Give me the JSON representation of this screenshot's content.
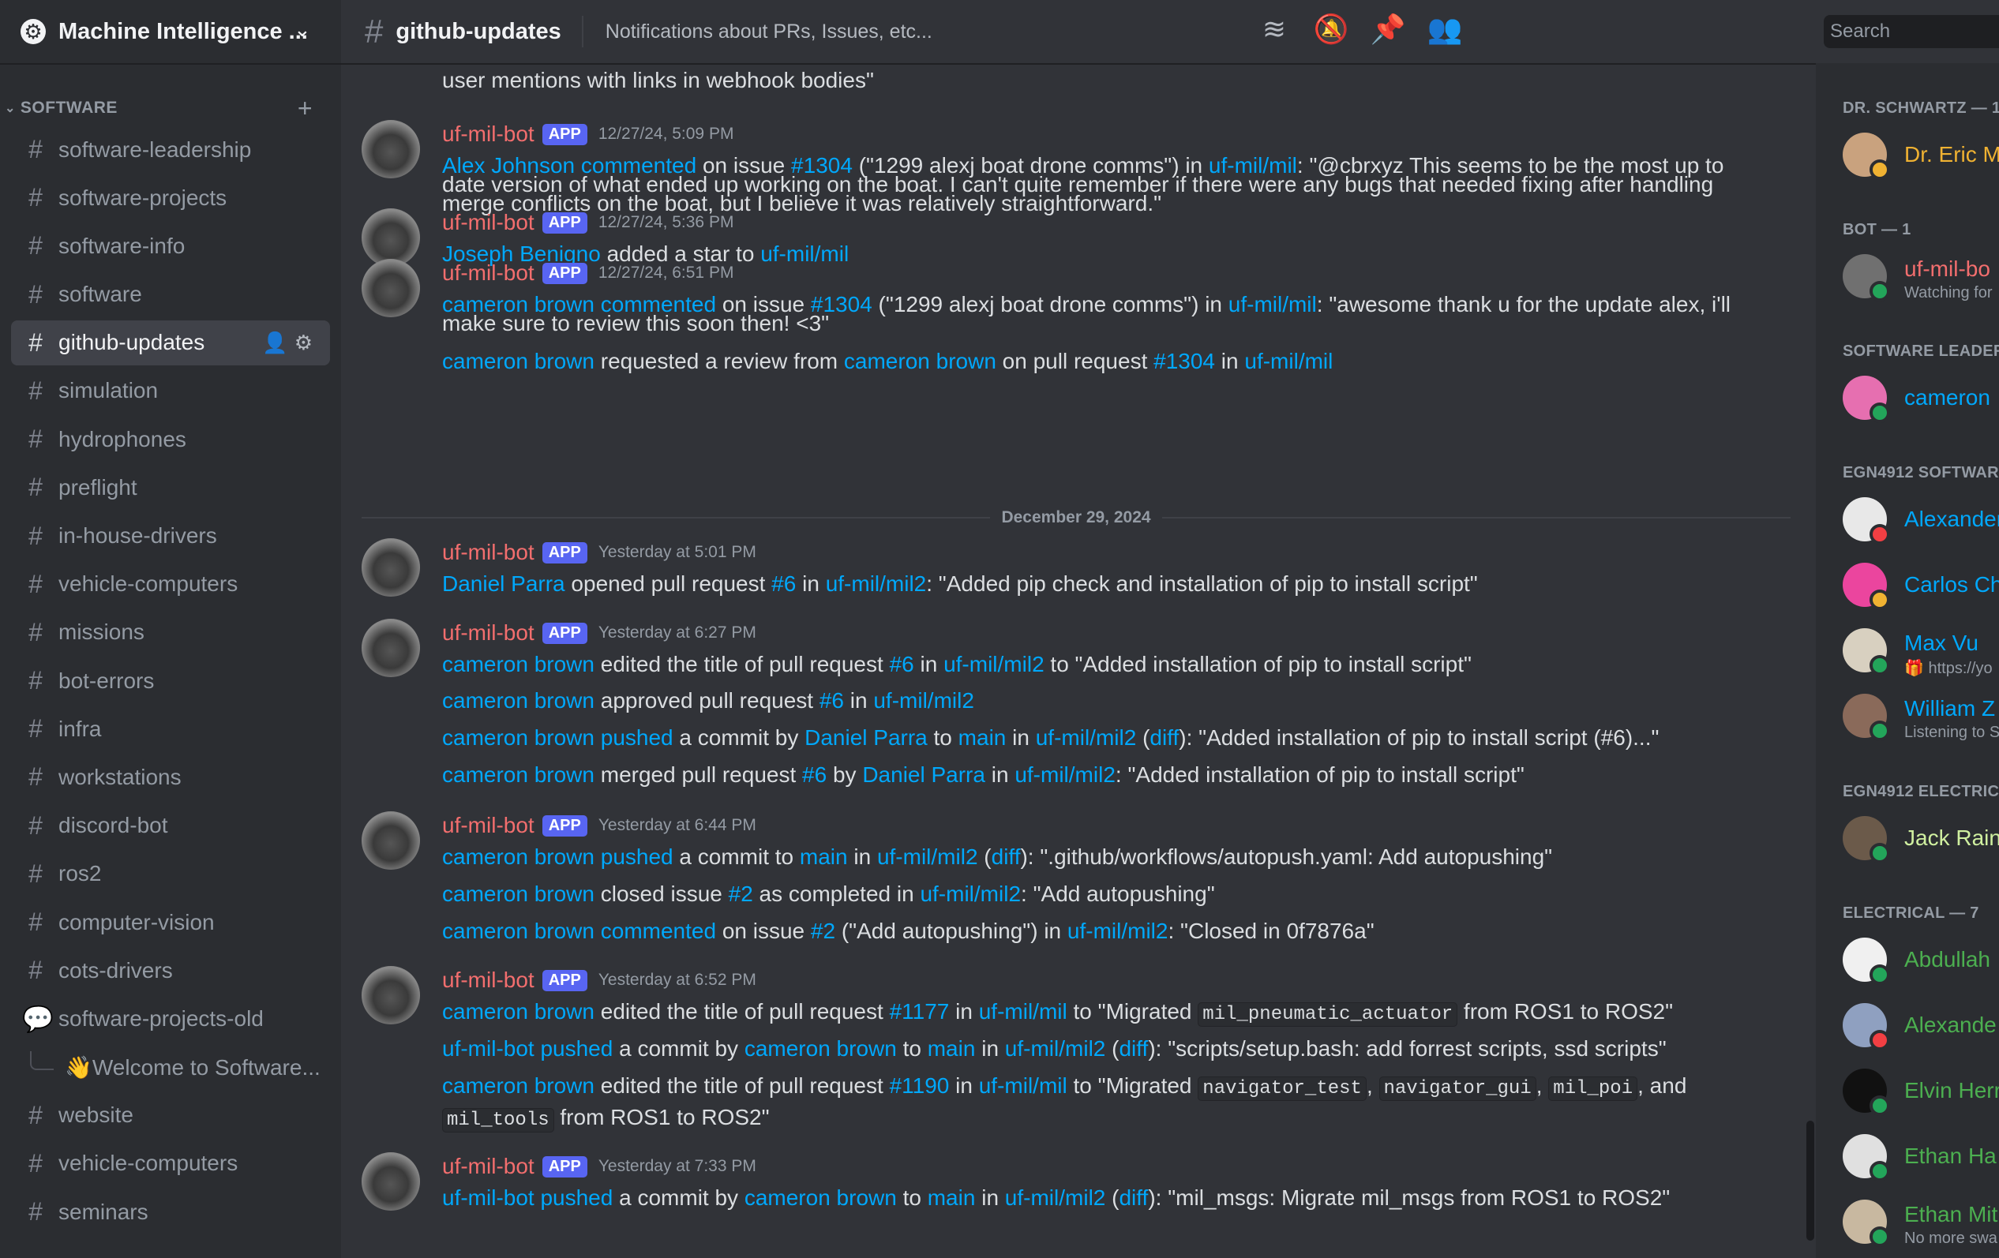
{
  "server": {
    "name": "Machine Intelligence ...",
    "icon": "gear-icon"
  },
  "sidebar": {
    "category": "SOFTWARE",
    "channels": [
      {
        "label": "software-leadership"
      },
      {
        "label": "software-projects"
      },
      {
        "label": "software-info"
      },
      {
        "label": "software"
      },
      {
        "label": "github-updates"
      },
      {
        "label": "simulation"
      },
      {
        "label": "hydrophones"
      },
      {
        "label": "preflight"
      },
      {
        "label": "in-house-drivers"
      },
      {
        "label": "vehicle-computers"
      },
      {
        "label": "missions"
      },
      {
        "label": "bot-errors"
      },
      {
        "label": "infra"
      },
      {
        "label": "workstations"
      },
      {
        "label": "discord-bot"
      },
      {
        "label": "ros2"
      },
      {
        "label": "computer-vision"
      },
      {
        "label": "cots-drivers"
      },
      {
        "label": "software-projects-old"
      },
      {
        "label": "👋Welcome to Software..."
      },
      {
        "label": "website"
      },
      {
        "label": "vehicle-computers"
      },
      {
        "label": "seminars"
      }
    ]
  },
  "topbar": {
    "channel": "github-updates",
    "topic": "Notifications about PRs, Issues, etc...",
    "search_placeholder": "Search"
  },
  "common": {
    "bot": "uf-mil-bot",
    "badge": "APP"
  },
  "messages": {
    "top_fragment": "user mentions with links in webhook bodies\"",
    "m1": {
      "ts": "12/27/24, 5:09 PM",
      "l1": [
        "Alex Johnson commented",
        " on issue ",
        "#1304",
        " (\"1299 alexj boat drone comms\") in ",
        "uf-mil/mil",
        ": \"@cbrxyz This seems to be the most up to"
      ],
      "l2": "date version of what ended up working on the boat. I can't quite remember if there were any bugs that needed fixing after handling",
      "l3": "merge conflicts on the boat, but I believe it was relatively straightforward.\""
    },
    "m2": {
      "ts": "12/27/24, 5:36 PM",
      "l1": [
        "Joseph Benigno",
        " added a star to ",
        "uf-mil/mil"
      ]
    },
    "m3": {
      "ts": "12/27/24, 6:51 PM",
      "l1": [
        "cameron brown commented",
        " on issue ",
        "#1304",
        " (\"1299 alexj boat drone comms\") in ",
        "uf-mil/mil",
        ": \"awesome thank u for the update alex, i'll"
      ],
      "l2": "make sure to review this soon then! <3\"",
      "l3": [
        "cameron brown",
        " requested a review from ",
        "cameron brown",
        " on pull request ",
        "#1304",
        " in ",
        "uf-mil/mil"
      ]
    },
    "date_sep": "December 29, 2024",
    "m4": {
      "ts": "Yesterday at 5:01 PM",
      "l1": [
        "Daniel Parra",
        " opened pull request ",
        "#6",
        " in ",
        "uf-mil/mil2",
        ": \"Added pip check and installation of pip to install script\""
      ]
    },
    "m5": {
      "ts": "Yesterday at 6:27 PM",
      "l1": [
        "cameron brown",
        " edited the title of pull request ",
        "#6",
        " in ",
        "uf-mil/mil2",
        " to \"Added installation of pip to install script\""
      ],
      "l2": [
        "cameron brown",
        " approved pull request ",
        "#6",
        " in ",
        "uf-mil/mil2"
      ],
      "l3": [
        "cameron brown pushed",
        " a commit by ",
        "Daniel Parra",
        " to ",
        "main",
        " in ",
        "uf-mil/mil2",
        " (",
        "diff",
        "): \"Added installation of pip to install script (#6)...\""
      ],
      "l4": [
        "cameron brown",
        " merged pull request ",
        "#6",
        " by ",
        "Daniel Parra",
        " in ",
        "uf-mil/mil2",
        ": \"Added installation of pip to install script\""
      ]
    },
    "m6": {
      "ts": "Yesterday at 6:44 PM",
      "l1": [
        "cameron brown pushed",
        " a commit to ",
        "main",
        " in ",
        "uf-mil/mil2",
        " (",
        "diff",
        "): \".github/workflows/autopush.yaml: Add autopushing\""
      ],
      "l2": [
        "cameron brown",
        " closed issue ",
        "#2",
        " as completed in ",
        "uf-mil/mil2",
        ": \"Add autopushing\""
      ],
      "l3": [
        "cameron brown commented",
        " on issue ",
        "#2",
        " (\"Add autopushing\") in ",
        "uf-mil/mil2",
        ": \"Closed in 0f7876a\""
      ]
    },
    "m7": {
      "ts": "Yesterday at 6:52 PM",
      "l1": [
        "cameron brown",
        " edited the title of pull request ",
        "#1177",
        " in ",
        "uf-mil/mil",
        " to \"Migrated ",
        "mil_pneumatic_actuator",
        " from ROS1 to ROS2\""
      ],
      "l2": [
        "uf-mil-bot pushed",
        " a commit by ",
        "cameron brown",
        " to ",
        "main",
        " in ",
        "uf-mil/mil2",
        " (",
        "diff",
        "): \"scripts/setup.bash: add forrest scripts, ssd scripts\""
      ],
      "l3": [
        "cameron brown",
        " edited the title of pull request ",
        "#1190",
        " in ",
        "uf-mil/mil",
        " to \"Migrated ",
        "navigator_test",
        ", ",
        "navigator_gui",
        ", ",
        "mil_poi",
        ", and"
      ],
      "l4": [
        "mil_tools",
        " from ROS1 to ROS2\""
      ]
    },
    "m8": {
      "ts": "Yesterday at 7:33 PM",
      "l1": [
        "uf-mil-bot pushed",
        " a commit by ",
        "cameron brown",
        " to ",
        "main",
        " in ",
        "uf-mil/mil2",
        " (",
        "diff",
        "): \"mil_msgs: Migrate mil_msgs from ROS1 to ROS2\""
      ]
    }
  },
  "members": {
    "groups": [
      {
        "label": "DR. SCHWARTZ — 1"
      },
      {
        "label": "BOT — 1"
      },
      {
        "label": "SOFTWARE LEADER"
      },
      {
        "label": "EGN4912 SOFTWAR"
      },
      {
        "label": "EGN4912 ELECTRIC"
      },
      {
        "label": "ELECTRICAL — 7"
      }
    ],
    "list": [
      {
        "name": "Dr. Eric M",
        "color": "#f0b232"
      },
      {
        "name": "uf-mil-bo",
        "color": "#f26e6e",
        "sub": "Watching for"
      },
      {
        "name": "cameron",
        "color": "#00a8fc"
      },
      {
        "name": "Alexander",
        "color": "#00a8fc"
      },
      {
        "name": "Carlos Ch",
        "color": "#00a8fc"
      },
      {
        "name": "Max Vu",
        "color": "#00a8fc",
        "sub": "🎁 https://yo"
      },
      {
        "name": "William Z",
        "color": "#00a8fc",
        "sub": "Listening to S"
      },
      {
        "name": "Jack Rain",
        "color": "#d0f0a0"
      },
      {
        "name": "Abdullah",
        "color": "#4caf50"
      },
      {
        "name": "Alexande",
        "color": "#4caf50"
      },
      {
        "name": "Elvin Herr",
        "color": "#4caf50"
      },
      {
        "name": "Ethan Ha",
        "color": "#4caf50"
      },
      {
        "name": "Ethan Mit",
        "color": "#4caf50",
        "sub": "No more swa"
      }
    ]
  },
  "colors": {
    "link": "#00a8fc",
    "bot": "#f26e6e",
    "badge": "#5865f2",
    "online": "#23a55a",
    "idle": "#f0b232",
    "dnd": "#f23f43"
  }
}
